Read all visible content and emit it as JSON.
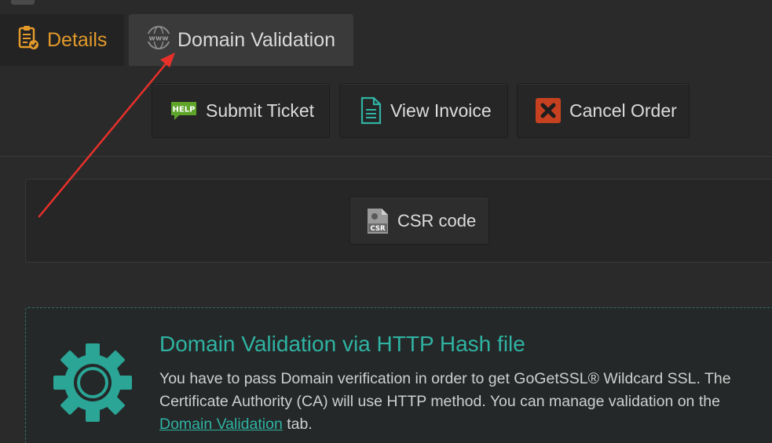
{
  "tabs": {
    "details_label": "Details",
    "domain_validation_label": "Domain Validation"
  },
  "actions": {
    "submit_ticket_label": "Submit Ticket",
    "view_invoice_label": "View Invoice",
    "cancel_order_label": "Cancel Order",
    "help_icon_text": "HELP"
  },
  "csr": {
    "button_label": "CSR code",
    "icon_text": "CSR"
  },
  "validation": {
    "title": "Domain Validation via HTTP Hash file",
    "text_before": "You have to pass Domain verification in order to get GoGetSSL® Wildcard SSL. The Certificate Authority (CA) will use HTTP method. You can manage validation on the ",
    "link_text": "Domain Validation",
    "text_after": " tab."
  },
  "icons": {
    "details": "clipboard-check-icon",
    "domain_validation": "www-globe-icon",
    "submit_ticket": "help-icon",
    "view_invoice": "document-icon",
    "cancel_order": "close-icon",
    "csr": "csr-file-icon",
    "validation": "gear-icon"
  },
  "colors": {
    "accent_orange": "#e39a2a",
    "accent_teal": "#2fb3a3",
    "help_green": "#5fa52a",
    "cancel_red": "#c6411f",
    "annotation_red": "#e8302a"
  }
}
